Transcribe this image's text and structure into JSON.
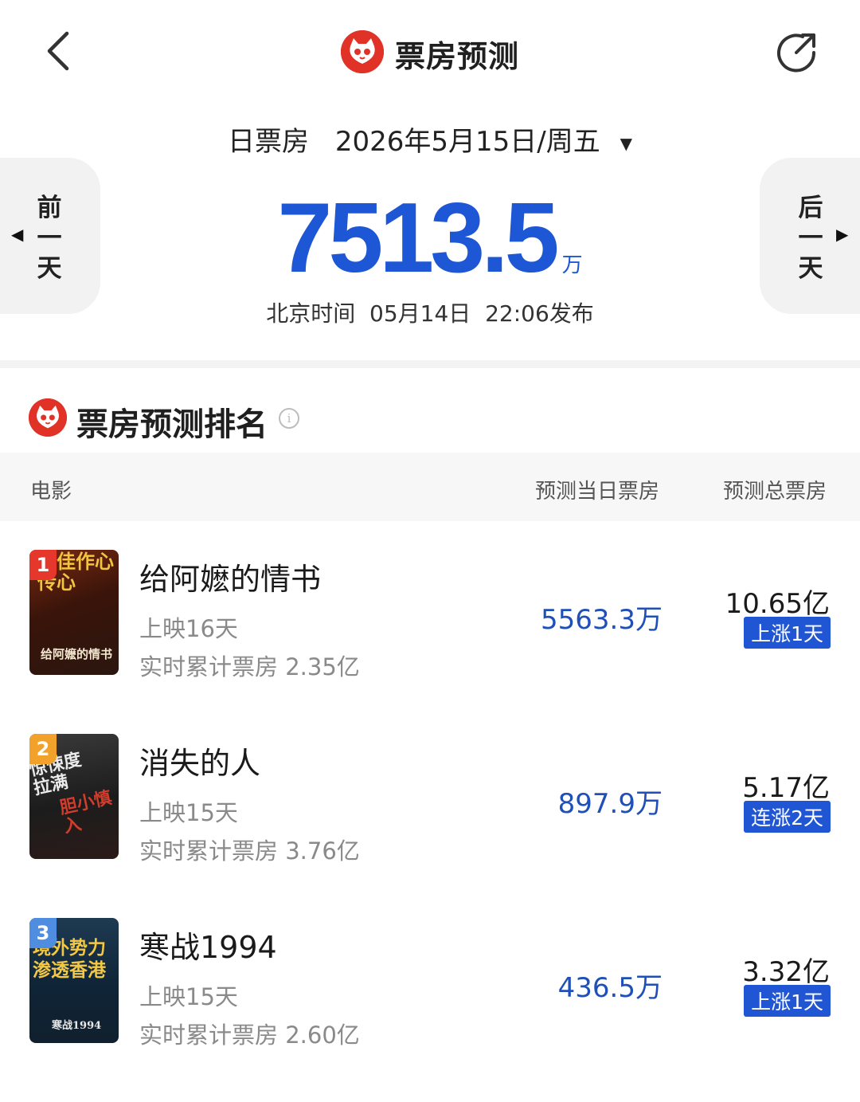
{
  "header": {
    "title": "票房预测",
    "back_icon": "chevron-left-icon",
    "share_icon": "share-icon"
  },
  "summary": {
    "type_label": "日票房",
    "date": "2026年5月15日/周五",
    "prev_day": "前一天",
    "next_day": "后一天",
    "total_value": "7513.5",
    "total_unit": "万",
    "publish_info": "北京时间  05月14日  22:06发布"
  },
  "ranking": {
    "title": "票房预测排名",
    "columns": {
      "movie": "电影",
      "daily": "预测当日票房",
      "total": "预测总票房"
    },
    "movies": [
      {
        "rank": "1",
        "title": "给阿嬷的情书",
        "days": "上映16天",
        "cumulative": "实时累计票房 2.35亿",
        "daily_forecast": "5563.3万",
        "total_forecast": "10.65亿",
        "trend": "上涨1天",
        "poster_text_top": "谭佳作心传心",
        "poster_text_bottom": "给阿嬷的情书"
      },
      {
        "rank": "2",
        "title": "消失的人",
        "days": "上映15天",
        "cumulative": "实时累计票房 3.76亿",
        "daily_forecast": "897.9万",
        "total_forecast": "5.17亿",
        "trend": "连涨2天",
        "poster_text_top": "惊悚度拉满",
        "poster_text_bottom": "胆小慎入"
      },
      {
        "rank": "3",
        "title": "寒战1994",
        "days": "上映15天",
        "cumulative": "实时累计票房 2.60亿",
        "daily_forecast": "436.5万",
        "total_forecast": "3.32亿",
        "trend": "上涨1天",
        "poster_text_top": "境外势力渗透香港",
        "poster_text_bottom": "寒战1994"
      }
    ]
  },
  "colors": {
    "accent_blue": "#1d57d6",
    "brand_red": "#e03226",
    "badge_1": "#e5372b",
    "badge_2": "#f2a12a",
    "badge_3": "#4f8de0"
  }
}
